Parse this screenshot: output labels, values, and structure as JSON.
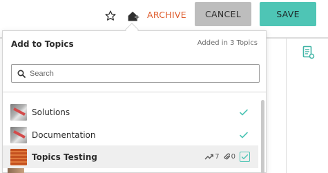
{
  "toolbar": {
    "favorite_icon": "star-outline-icon",
    "add_home_icon": "home-plus-icon",
    "archive_label": "ARCHIVE",
    "cancel_label": "CANCEL",
    "save_label": "SAVE",
    "colors": {
      "archive": "#de5a2a",
      "cancel_bg": "#bdbdbd",
      "save_bg": "#4ec5b5"
    }
  },
  "background": {
    "doc_icon": "document-settings-icon"
  },
  "popup": {
    "title": "Add to Topics",
    "status": "Added in 3 Topics",
    "search": {
      "placeholder": "Search",
      "value": ""
    },
    "topics": [
      {
        "label": "Solutions",
        "thumbnail": "gray-pen-thumbnail",
        "added": true
      },
      {
        "label": "Documentation",
        "thumbnail": "gray-pen-thumbnail",
        "added": true
      },
      {
        "label": "Topics Testing",
        "thumbnail": "orange-wall-thumbnail",
        "selected": true,
        "trend_count": "7",
        "attachment_count": "0",
        "checked": true
      }
    ],
    "accent_color": "#4ec5b5"
  }
}
